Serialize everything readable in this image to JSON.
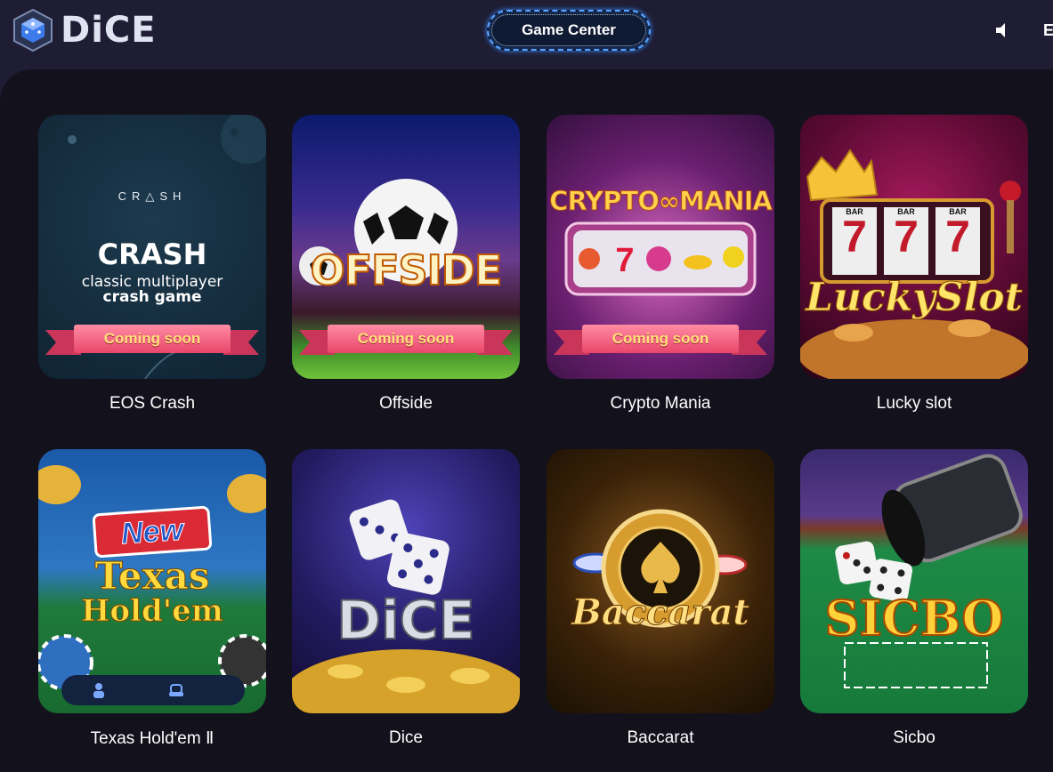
{
  "brand": {
    "name": "DiCE"
  },
  "nav": {
    "game_center": "Game Center",
    "lang_letter": "E"
  },
  "badge": {
    "coming_soon": "Coming soon"
  },
  "games": [
    {
      "title": "EOS Crash",
      "art": {
        "logo": "CR△SH",
        "headline": "CRASH",
        "line1": "classic multiplayer",
        "line2": "crash game"
      }
    },
    {
      "title": "Offside",
      "art": {
        "headline": "OFFSIDE"
      }
    },
    {
      "title": "Crypto Mania",
      "art": {
        "headline": "CRYPTO∞MANIA"
      }
    },
    {
      "title": "Lucky slot",
      "art": {
        "reel1": "7",
        "reel2": "7",
        "reel3": "7",
        "bar": "BAR",
        "headline": "LuckySlot"
      }
    },
    {
      "title": "Texas Hold'em Ⅱ",
      "art": {
        "badge": "New",
        "line1": "Texas",
        "line2": "Hold'em"
      }
    },
    {
      "title": "Dice",
      "art": {
        "headline": "DiCE"
      }
    },
    {
      "title": "Baccarat",
      "art": {
        "headline": "Baccarat"
      }
    },
    {
      "title": "Sicbo",
      "art": {
        "headline": "SICBO"
      }
    }
  ],
  "colors": {
    "topbar": "#1e1d33",
    "panel": "#12111c",
    "accent": "#3c7bea"
  }
}
